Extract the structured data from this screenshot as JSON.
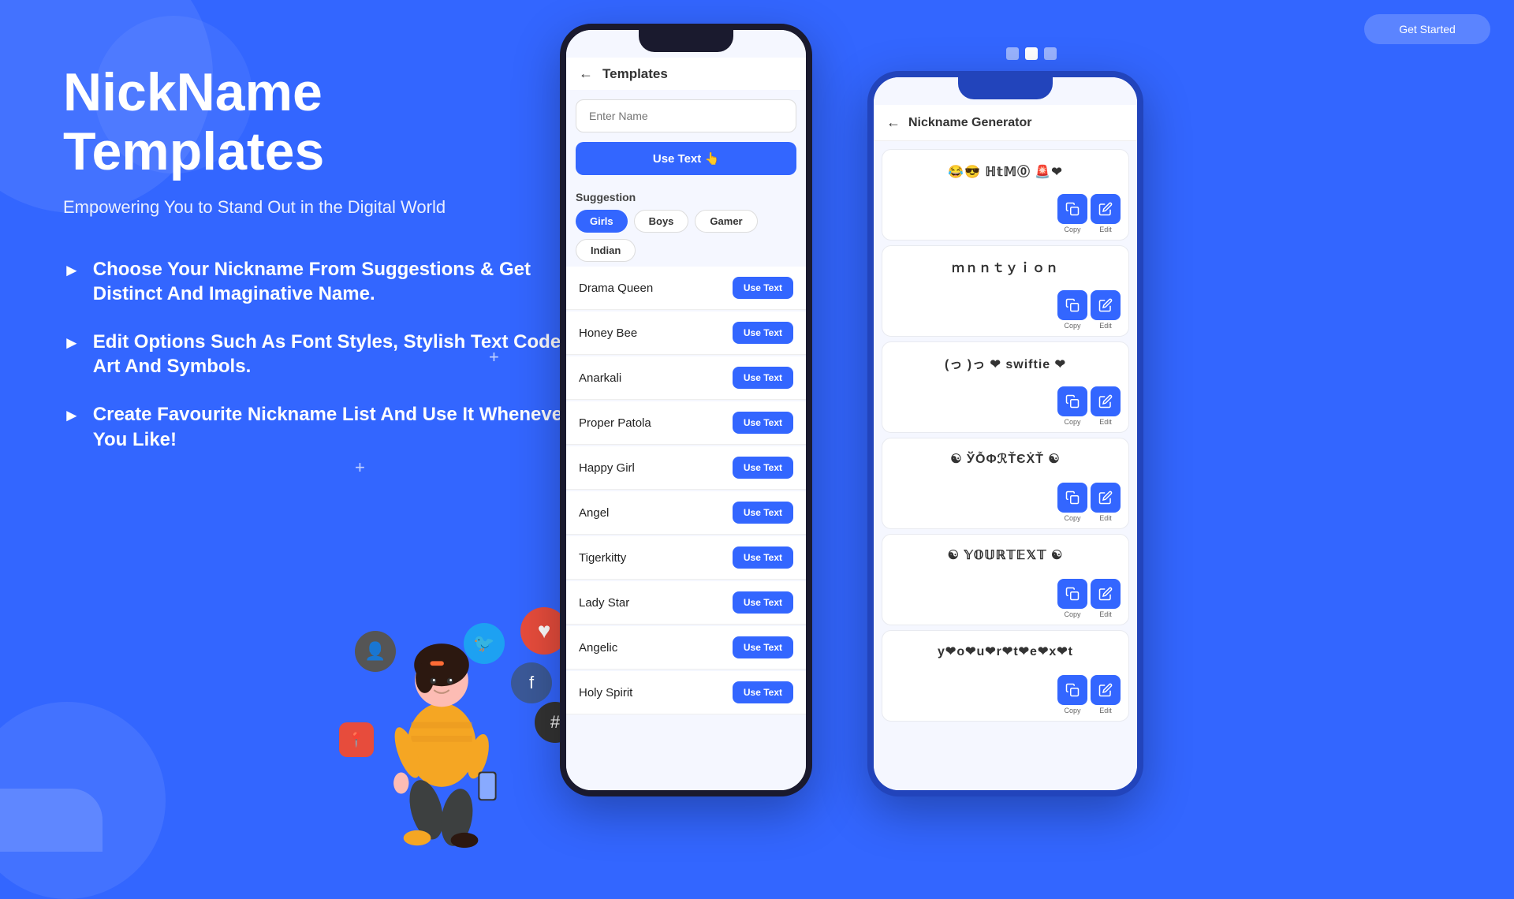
{
  "app": {
    "title": "NickName Templates",
    "subtitle": "Empowering You to Stand Out in the Digital World",
    "top_button": "Get Started",
    "features": [
      "Choose Your Nickname From Suggestions & Get Distinct And Imaginative Name.",
      "Edit Options Such As Font Styles, Stylish Text Codes, Art And Symbols.",
      "Create Favourite Nickname List And Use It Whenever You Like!"
    ]
  },
  "phone1": {
    "title": "Templates",
    "input_placeholder": "Enter Name",
    "use_text_btn": "Use Text 👆",
    "suggestion_label": "Suggestion",
    "chips": [
      "Girls",
      "Boys",
      "Gamer",
      "Indian"
    ],
    "active_chip": "Girls",
    "nicknames": [
      "Drama Queen",
      "Honey Bee",
      "Anarkali",
      "Proper Patola",
      "Happy Girl",
      "Angel",
      "Tigerkitty",
      "Lady Star",
      "Angelic",
      "Holy Spirit"
    ],
    "use_text_label": "Use Text"
  },
  "phone2": {
    "title": "Nickname Generator",
    "items": [
      {
        "text": "😂😎 ℍ𝕥𝕄⓪ 🚨❤",
        "copy": "Copy",
        "edit": "Edit"
      },
      {
        "text": "ｍｎｎｔｙｉｏｎ",
        "copy": "Copy",
        "edit": "Edit"
      },
      {
        "text": "(っ )っ ❤ swiftie ❤",
        "copy": "Copy",
        "edit": "Edit"
      },
      {
        "text": "☯ ЎỖΦℛŤЄẊŤ ☯",
        "copy": "Copy",
        "edit": "Edit"
      },
      {
        "text": "☯ 𝕐𝕆𝕌ℝ𝕋𝔼𝕏𝕋 ☯",
        "copy": "Copy",
        "edit": "Edit"
      },
      {
        "text": "y❤o❤u❤r❤t❤e❤x❤t",
        "copy": "Copy",
        "edit": "Edit"
      }
    ]
  },
  "dots": [
    "dot1",
    "dot2",
    "dot3"
  ],
  "icons": {
    "copy": "⧉",
    "edit": "✎",
    "back": "←",
    "hand": "👆"
  }
}
